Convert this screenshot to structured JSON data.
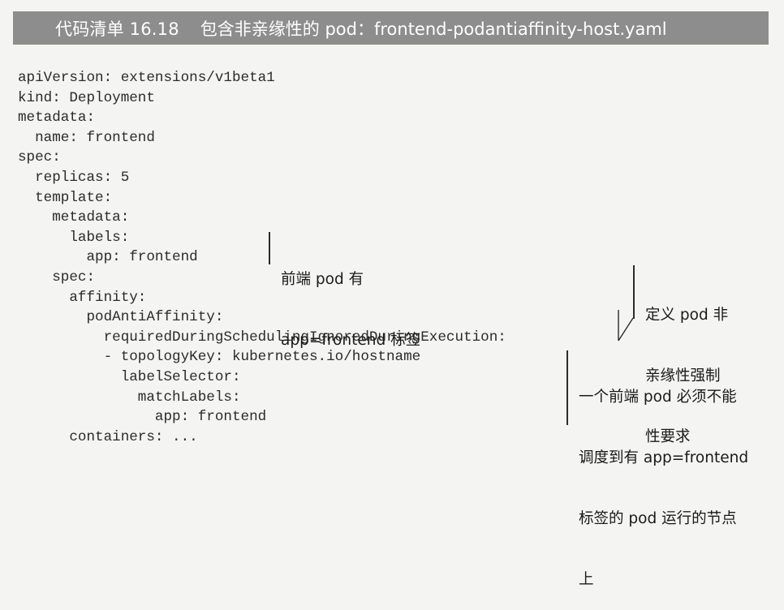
{
  "header": {
    "listing_number": "代码清单 16.18",
    "listing_title": "包含非亲缘性的 pod：frontend-podantiaffinity-host.yaml"
  },
  "code": {
    "lines": [
      "apiVersion: extensions/v1beta1",
      "kind: Deployment",
      "metadata:",
      "  name: frontend",
      "spec:",
      "  replicas: 5",
      "  template:",
      "    metadata:",
      "      labels:",
      "        app: frontend",
      "    spec:",
      "      affinity:",
      "        podAntiAffinity:",
      "          requiredDuringSchedulingIgnoredDuringExecution:",
      "          - topologyKey: kubernetes.io/hostname",
      "            labelSelector:",
      "              matchLabels:",
      "                app: frontend",
      "      containers: ..."
    ]
  },
  "annotations": {
    "frontend_label": [
      "前端 pod 有",
      "app=frontend 标签"
    ],
    "anti_affinity": [
      "定义 pod 非",
      "亲缘性强制",
      "性要求"
    ],
    "scheduling_rule": [
      "一个前端 pod 必须不能",
      "调度到有 app=frontend",
      "标签的 pod 运行的节点",
      "上"
    ]
  }
}
